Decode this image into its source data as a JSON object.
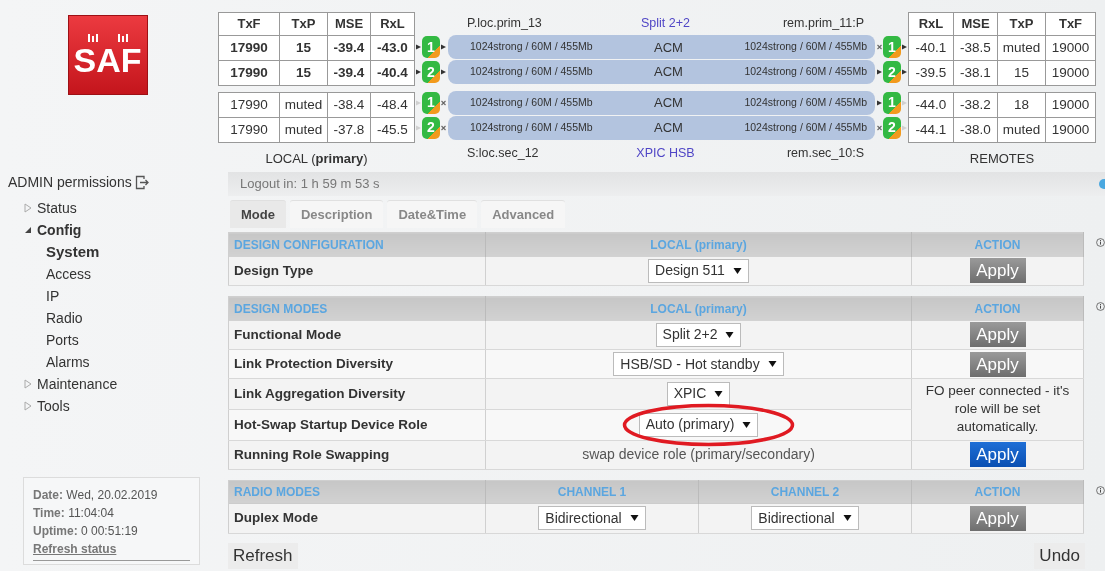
{
  "logo": {
    "text": "SAF"
  },
  "local_table": {
    "columns": [
      "TxF",
      "TxP",
      "MSE",
      "RxL"
    ],
    "groups": [
      {
        "bold": true,
        "rows": [
          [
            "17990",
            "15",
            "-39.4",
            "-43.0"
          ],
          [
            "17990",
            "15",
            "-39.4",
            "-40.4"
          ]
        ]
      },
      {
        "bold": false,
        "rows": [
          [
            "17990",
            "muted",
            "-38.4",
            "-48.4"
          ],
          [
            "17990",
            "muted",
            "-37.8",
            "-45.5"
          ]
        ]
      }
    ],
    "caption": "LOCAL (**primary**)"
  },
  "links": {
    "header": [
      "P.loc.prim_13",
      "Split 2+2",
      "rem.prim_11:P"
    ],
    "groups": [
      [
        {
          "local_channel": "1",
          "local_marks": [
            {
              "kind": "arrow"
            },
            {
              "kind": "arrow"
            }
          ],
          "local_text": "1024strong / 60M / 455Mb",
          "mode": "ACM",
          "remote_text": "1024strong / 60M / 455Mb",
          "remote_marks": [
            {
              "kind": "cross"
            },
            {
              "kind": "arrow"
            }
          ],
          "remote_channel": "1"
        },
        {
          "local_channel": "2",
          "local_marks": [
            {
              "kind": "arrow"
            },
            {
              "kind": "arrow"
            }
          ],
          "local_text": "1024strong / 60M / 455Mb",
          "mode": "ACM",
          "remote_text": "1024strong / 60M / 455Mb",
          "remote_marks": [
            {
              "kind": "arrow"
            },
            {
              "kind": "arrow"
            }
          ],
          "remote_channel": "2"
        }
      ],
      [
        {
          "local_channel": "1",
          "local_marks": [
            {
              "kind": "faint"
            },
            {
              "kind": "cross"
            }
          ],
          "local_text": "1024strong / 60M / 455Mb",
          "mode": "ACM",
          "remote_text": "1024strong / 60M / 455Mb",
          "remote_marks": [
            {
              "kind": "arrow"
            },
            {
              "kind": "faint"
            }
          ],
          "remote_channel": "1"
        },
        {
          "local_channel": "2",
          "local_marks": [
            {
              "kind": "faint"
            },
            {
              "kind": "cross"
            }
          ],
          "local_text": "1024strong / 60M / 455Mb",
          "mode": "ACM",
          "remote_text": "1024strong / 60M / 455Mb",
          "remote_marks": [
            {
              "kind": "cross"
            },
            {
              "kind": "faint"
            }
          ],
          "remote_channel": "2"
        }
      ]
    ],
    "footer": [
      "S:loc.sec_12",
      "XPIC HSB",
      "rem.sec_10:S"
    ]
  },
  "remote_table": {
    "columns": [
      "RxL",
      "MSE",
      "TxP",
      "TxF"
    ],
    "groups": [
      {
        "bold": false,
        "rows": [
          [
            "-40.1",
            "-38.5",
            "muted",
            "19000"
          ],
          [
            "-39.5",
            "-38.1",
            "15",
            "19000"
          ]
        ]
      },
      {
        "bold": false,
        "rows": [
          [
            "-44.0",
            "-38.2",
            "18",
            "19000"
          ],
          [
            "-44.1",
            "-38.0",
            "muted",
            "19000"
          ]
        ]
      }
    ],
    "caption": "REMOTES"
  },
  "sidebar": {
    "permissions": "ADMIN permissions",
    "nav": [
      {
        "label": "Status",
        "expanded": false
      },
      {
        "label": "Config",
        "expanded": true,
        "children": [
          {
            "label": "System",
            "selected": true
          },
          {
            "label": "Access",
            "selected": false
          },
          {
            "label": "IP",
            "selected": false
          },
          {
            "label": "Radio",
            "selected": false
          },
          {
            "label": "Ports",
            "selected": false
          },
          {
            "label": "Alarms",
            "selected": false
          }
        ]
      },
      {
        "label": "Maintenance",
        "expanded": false
      },
      {
        "label": "Tools",
        "expanded": false
      }
    ],
    "status": [
      {
        "label": "Date:",
        "value": "Wed, 20.02.2019"
      },
      {
        "label": "Time:",
        "value": "11:04:04"
      },
      {
        "label": "Uptime:",
        "value": "0 00:51:19"
      }
    ],
    "refresh_link": "Refresh status"
  },
  "logout": "Logout in: 1 h 59 m 53 s",
  "tabs": [
    {
      "label": "Mode",
      "selected": true
    },
    {
      "label": "Description",
      "selected": false
    },
    {
      "label": "Date&Time",
      "selected": false
    },
    {
      "label": "Advanced",
      "selected": false
    }
  ],
  "sections": [
    {
      "headers": [
        "DESIGN CONFIGURATION",
        "LOCAL (primary)",
        "ACTION"
      ],
      "rows": [
        {
          "label": "Design Type",
          "cells": [
            {
              "kind": "select",
              "value": "Design 511",
              "highlighted": false
            }
          ],
          "action": {
            "kind": "button",
            "label": "Apply",
            "enabled": false
          }
        }
      ]
    },
    {
      "headers": [
        "DESIGN MODES",
        "LOCAL (primary)",
        "ACTION"
      ],
      "rows": [
        {
          "label": "Functional Mode",
          "cells": [
            {
              "kind": "select",
              "value": "Split 2+2",
              "highlighted": false
            }
          ],
          "action": {
            "kind": "button",
            "label": "Apply",
            "enabled": false
          }
        },
        {
          "label": "Link Protection Diversity",
          "cells": [
            {
              "kind": "select",
              "value": "HSB/SD - Hot standby",
              "highlighted": false
            }
          ],
          "action": {
            "kind": "button",
            "label": "Apply",
            "enabled": false
          }
        },
        {
          "label": "Link Aggregation Diversity",
          "cells": [
            {
              "kind": "select",
              "value": "XPIC",
              "highlighted": false
            }
          ],
          "action": {
            "kind": "note",
            "text": "FO peer connected - it's role will be set automatically."
          }
        },
        {
          "label": "Hot-Swap Startup Device Role",
          "cells": [
            {
              "kind": "select",
              "value": "Auto (primary)",
              "highlighted": true
            }
          ]
        },
        {
          "label": "Running Role Swapping",
          "cells": [
            {
              "kind": "text",
              "value": "swap device role (primary/secondary)"
            }
          ],
          "action": {
            "kind": "button",
            "label": "Apply",
            "enabled": true
          }
        }
      ]
    },
    {
      "headers": [
        "RADIO MODES",
        "CHANNEL 1",
        "CHANNEL 2",
        "ACTION"
      ],
      "rows": [
        {
          "label": "Duplex Mode",
          "cells": [
            {
              "kind": "select",
              "value": "Bidirectional",
              "highlighted": false
            },
            {
              "kind": "select",
              "value": "Bidirectional",
              "highlighted": false
            }
          ],
          "action": {
            "kind": "button",
            "label": "Apply",
            "enabled": false
          }
        }
      ]
    }
  ],
  "buttons": {
    "refresh": "Refresh",
    "undo": "Undo"
  }
}
